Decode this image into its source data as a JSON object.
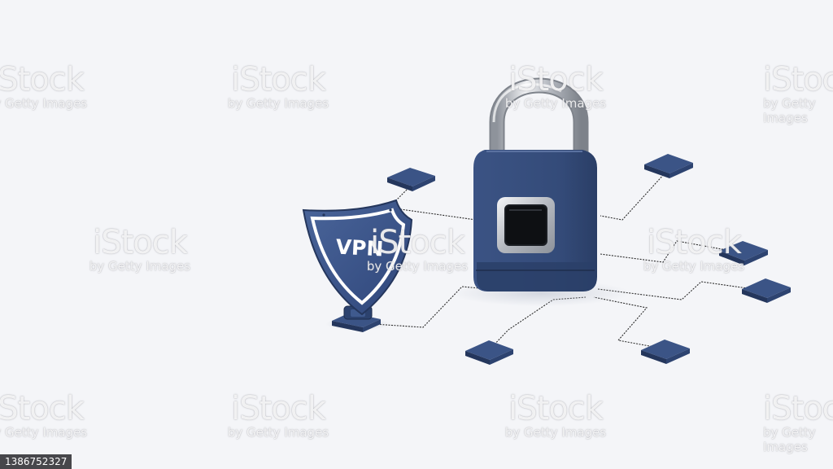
{
  "shield": {
    "label": "VPN"
  },
  "watermark": {
    "brand": "iStock",
    "credit": "by Getty Images"
  },
  "image_id": "1386752327",
  "colors": {
    "background": "#f4f5f8",
    "navy": "#3a5487",
    "navy_dark": "#24365c",
    "silver": "#c9ccd2",
    "trace": "#2b2b2b"
  }
}
